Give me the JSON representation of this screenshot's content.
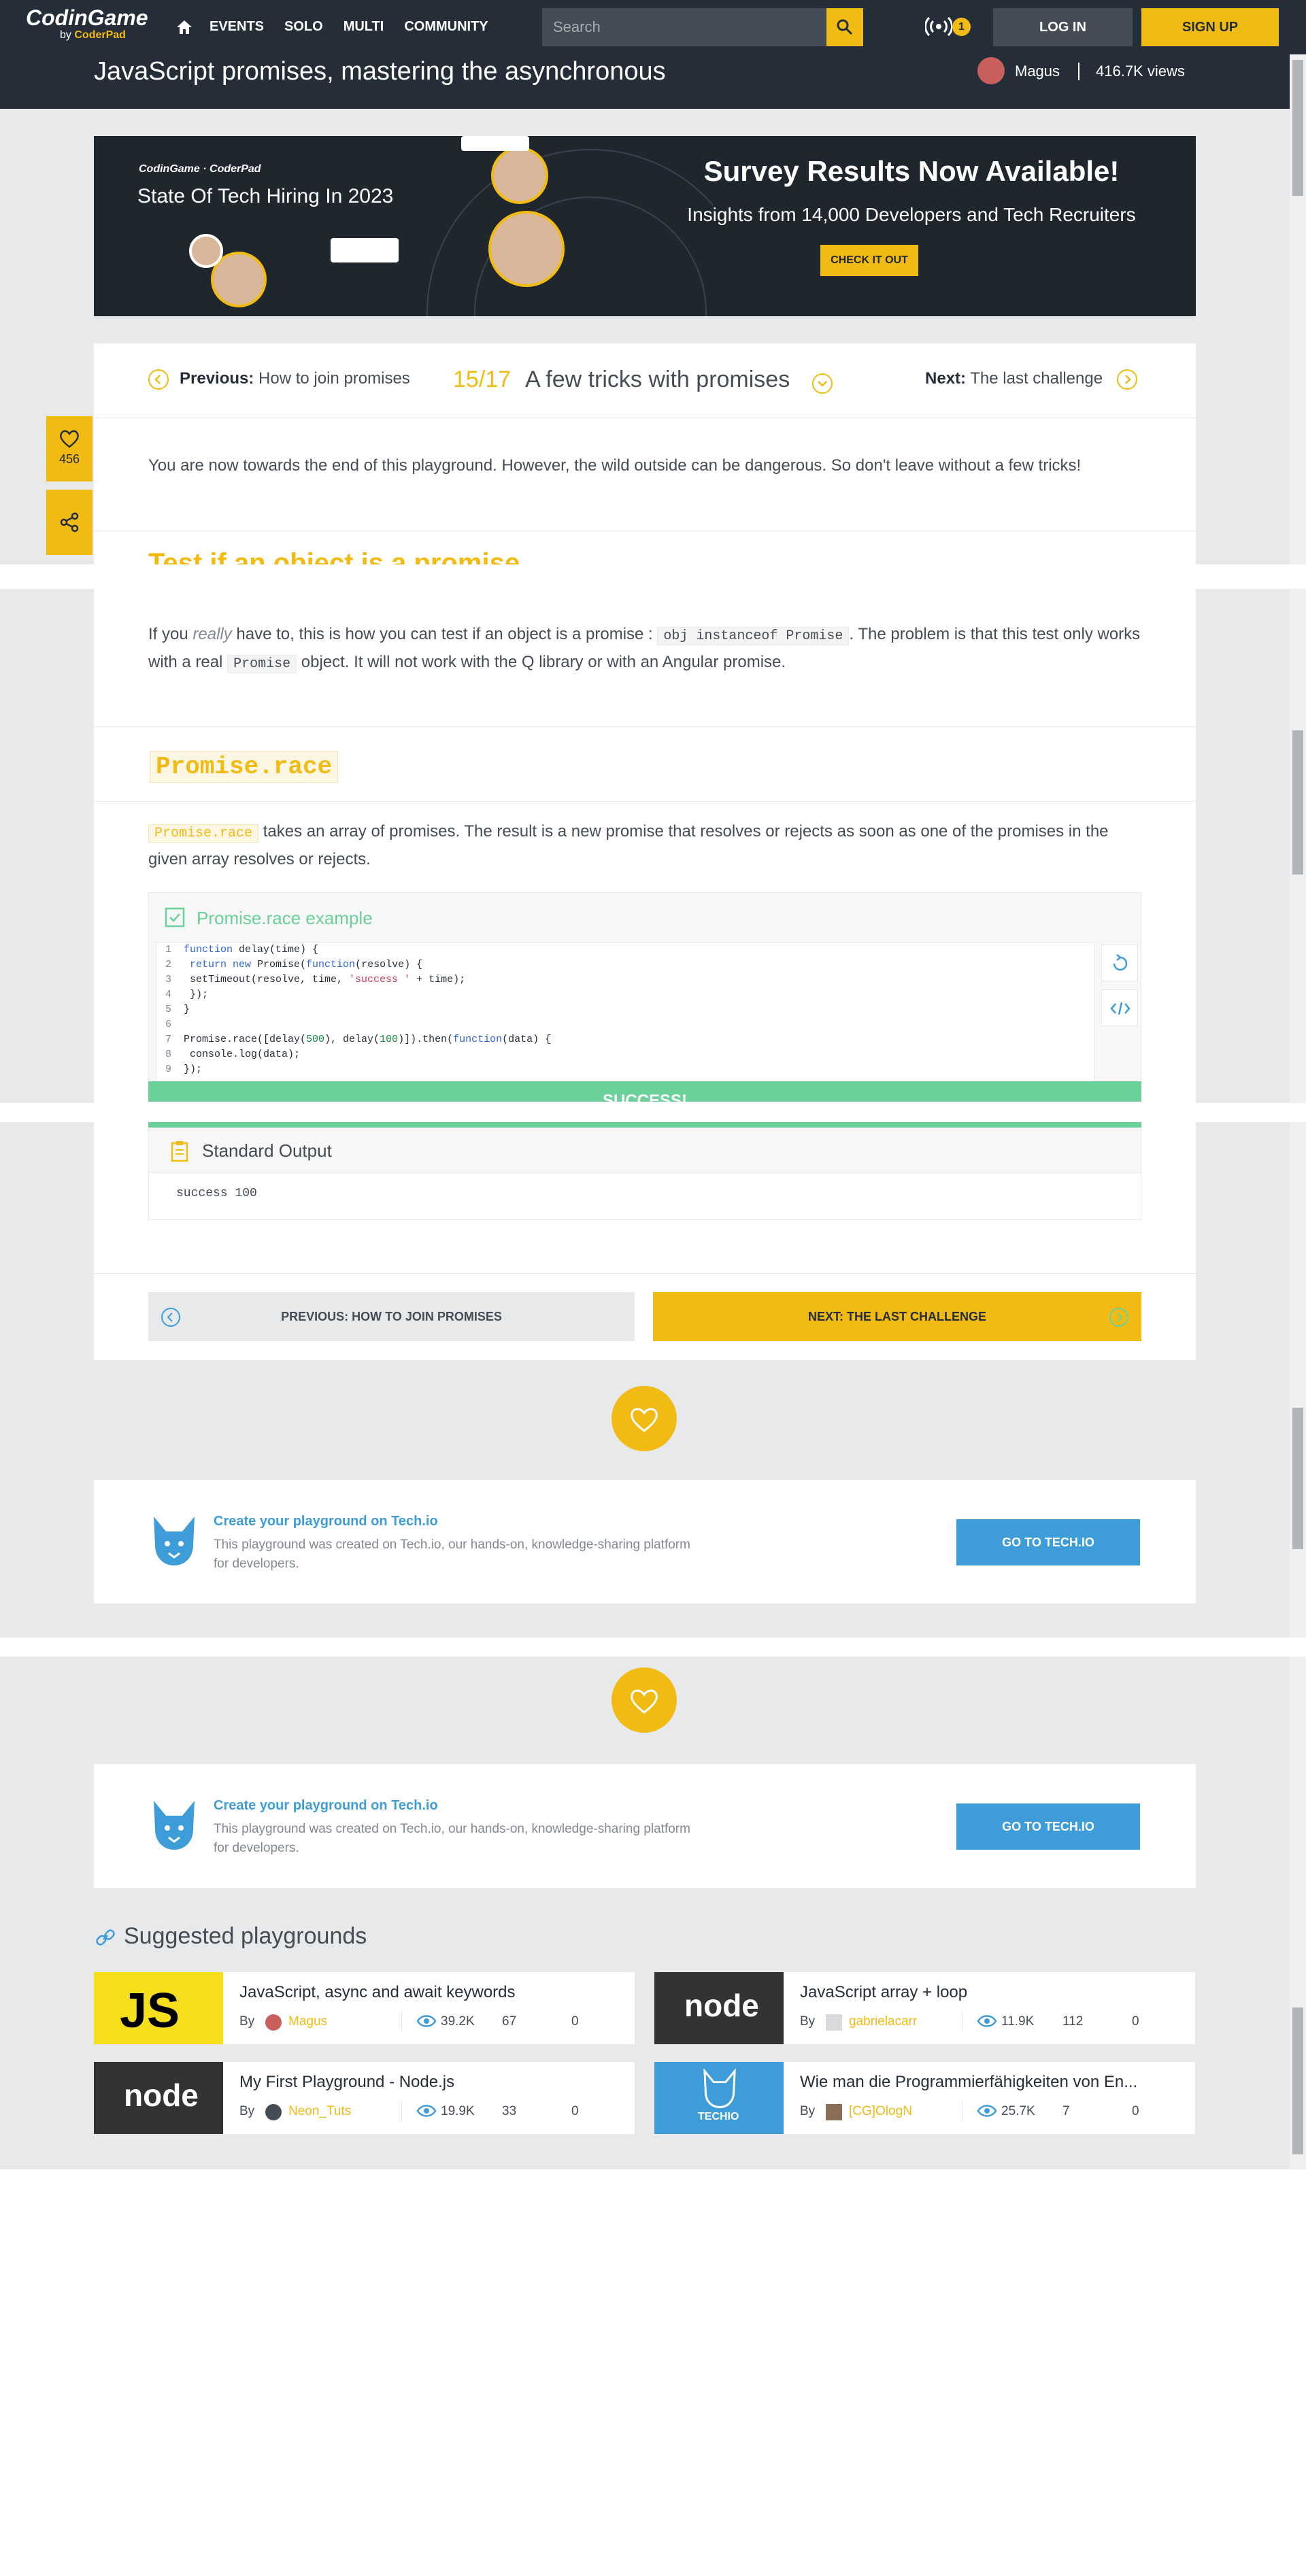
{
  "nav": {
    "logo_main": "CodinGame",
    "logo_sub_by": "by",
    "logo_sub_brand": "CoderPad",
    "links": [
      "EVENTS",
      "SOLO",
      "MULTI",
      "COMMUNITY"
    ],
    "search_placeholder": "Search",
    "notification_count": "1",
    "login_label": "LOG IN",
    "signup_label": "SIGN UP"
  },
  "header": {
    "title": "JavaScript promises, mastering the asynchronous",
    "author": "Magus",
    "views": "416.7K views"
  },
  "banner": {
    "brand_line": "CodinGame · CoderPad",
    "subtitle": "State Of Tech Hiring In 2023",
    "headline": "Survey Results Now Available!",
    "text": "Insights from 14,000 Developers and Tech Recruiters",
    "cta": "CHECK IT OUT"
  },
  "lesson_nav": {
    "previous_label": "Previous:",
    "previous_title": "How to join promises",
    "position": "15/17",
    "current_title": "A few tricks with promises",
    "next_label": "Next:",
    "next_title": "The last challenge"
  },
  "side": {
    "likes": "456"
  },
  "content": {
    "intro": "You are now towards the end of this playground. However, the wild outside can be dangerous. So don't leave without a few tricks!",
    "section1_title": "Test if an object is a promise",
    "section1_p_a": "If you ",
    "section1_p_em": "really",
    "section1_p_b": " have to, this is how you can test if an object is a promise : ",
    "section1_code1": "obj instanceof Promise",
    "section1_p_c": ". The problem is that this test only works",
    "section1_p_d": "with a real ",
    "section1_code2": "Promise",
    "section1_p_e": " object. It will not work with the Q library or with an Angular promise.",
    "section2_title": "Promise.race",
    "section2_code": "Promise.race",
    "section2_p_a": " takes an array of promises. The result is a new promise that resolves or rejects as soon as one of the promises in the",
    "section2_p_b": "given array resolves or rejects."
  },
  "code_block": {
    "label": "Promise.race example",
    "run_label": "SUCCESS!",
    "lines": [
      "function delay(time) {",
      "    return new Promise(function(resolve) {",
      "        setTimeout(resolve, time, 'success ' + time);",
      "    });",
      "}",
      "",
      "Promise.race([delay(500), delay(100)]).then(function(data) {",
      "    console.log(data);",
      "});"
    ]
  },
  "output": {
    "label": "Standard Output",
    "text": "success 100"
  },
  "pager": {
    "prev": "PREVIOUS: HOW TO JOIN PROMISES",
    "next": "NEXT: THE LAST CHALLENGE"
  },
  "techio": {
    "title": "Create your playground on Tech.io",
    "desc": "This playground was created on Tech.io, our hands-on, knowledge-sharing platform for developers.",
    "button": "GO TO TECH.IO"
  },
  "suggested": {
    "title": "Suggested playgrounds",
    "items": [
      {
        "title": "JavaScript, async and await keywords",
        "by": "By",
        "user": "Magus",
        "views": "39.2K",
        "likes": "67",
        "comments": "0",
        "thumb": "JS"
      },
      {
        "title": "JavaScript array + loop",
        "by": "By",
        "user": "gabrielacarr",
        "views": "11.9K",
        "likes": "112",
        "comments": "0",
        "thumb": "node"
      },
      {
        "title": "My First Playground - Node.js",
        "by": "By",
        "user": "Neon_Tuts",
        "views": "19.9K",
        "likes": "33",
        "comments": "0",
        "thumb": "node"
      },
      {
        "title": "Wie man die Programmierfähigkeiten von En...",
        "by": "By",
        "user": "[CG]OlogN",
        "views": "25.7K",
        "likes": "7",
        "comments": "0",
        "thumb": "TECHIO"
      }
    ]
  },
  "colors": {
    "accent": "#f2bb13",
    "navbar": "#252e38",
    "success": "#6bd09a",
    "link": "#3e9dd8"
  }
}
